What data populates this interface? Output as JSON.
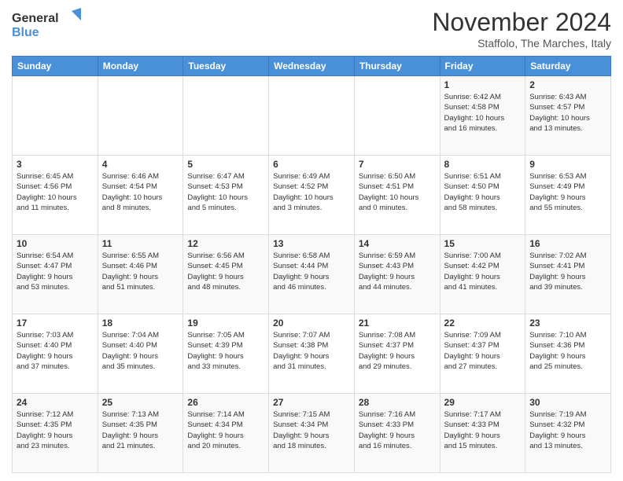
{
  "logo": {
    "line1": "General",
    "line2": "Blue"
  },
  "title": "November 2024",
  "subtitle": "Staffolo, The Marches, Italy",
  "days_header": [
    "Sunday",
    "Monday",
    "Tuesday",
    "Wednesday",
    "Thursday",
    "Friday",
    "Saturday"
  ],
  "weeks": [
    [
      {
        "day": "",
        "info": ""
      },
      {
        "day": "",
        "info": ""
      },
      {
        "day": "",
        "info": ""
      },
      {
        "day": "",
        "info": ""
      },
      {
        "day": "",
        "info": ""
      },
      {
        "day": "1",
        "info": "Sunrise: 6:42 AM\nSunset: 4:58 PM\nDaylight: 10 hours\nand 16 minutes."
      },
      {
        "day": "2",
        "info": "Sunrise: 6:43 AM\nSunset: 4:57 PM\nDaylight: 10 hours\nand 13 minutes."
      }
    ],
    [
      {
        "day": "3",
        "info": "Sunrise: 6:45 AM\nSunset: 4:56 PM\nDaylight: 10 hours\nand 11 minutes."
      },
      {
        "day": "4",
        "info": "Sunrise: 6:46 AM\nSunset: 4:54 PM\nDaylight: 10 hours\nand 8 minutes."
      },
      {
        "day": "5",
        "info": "Sunrise: 6:47 AM\nSunset: 4:53 PM\nDaylight: 10 hours\nand 5 minutes."
      },
      {
        "day": "6",
        "info": "Sunrise: 6:49 AM\nSunset: 4:52 PM\nDaylight: 10 hours\nand 3 minutes."
      },
      {
        "day": "7",
        "info": "Sunrise: 6:50 AM\nSunset: 4:51 PM\nDaylight: 10 hours\nand 0 minutes."
      },
      {
        "day": "8",
        "info": "Sunrise: 6:51 AM\nSunset: 4:50 PM\nDaylight: 9 hours\nand 58 minutes."
      },
      {
        "day": "9",
        "info": "Sunrise: 6:53 AM\nSunset: 4:49 PM\nDaylight: 9 hours\nand 55 minutes."
      }
    ],
    [
      {
        "day": "10",
        "info": "Sunrise: 6:54 AM\nSunset: 4:47 PM\nDaylight: 9 hours\nand 53 minutes."
      },
      {
        "day": "11",
        "info": "Sunrise: 6:55 AM\nSunset: 4:46 PM\nDaylight: 9 hours\nand 51 minutes."
      },
      {
        "day": "12",
        "info": "Sunrise: 6:56 AM\nSunset: 4:45 PM\nDaylight: 9 hours\nand 48 minutes."
      },
      {
        "day": "13",
        "info": "Sunrise: 6:58 AM\nSunset: 4:44 PM\nDaylight: 9 hours\nand 46 minutes."
      },
      {
        "day": "14",
        "info": "Sunrise: 6:59 AM\nSunset: 4:43 PM\nDaylight: 9 hours\nand 44 minutes."
      },
      {
        "day": "15",
        "info": "Sunrise: 7:00 AM\nSunset: 4:42 PM\nDaylight: 9 hours\nand 41 minutes."
      },
      {
        "day": "16",
        "info": "Sunrise: 7:02 AM\nSunset: 4:41 PM\nDaylight: 9 hours\nand 39 minutes."
      }
    ],
    [
      {
        "day": "17",
        "info": "Sunrise: 7:03 AM\nSunset: 4:40 PM\nDaylight: 9 hours\nand 37 minutes."
      },
      {
        "day": "18",
        "info": "Sunrise: 7:04 AM\nSunset: 4:40 PM\nDaylight: 9 hours\nand 35 minutes."
      },
      {
        "day": "19",
        "info": "Sunrise: 7:05 AM\nSunset: 4:39 PM\nDaylight: 9 hours\nand 33 minutes."
      },
      {
        "day": "20",
        "info": "Sunrise: 7:07 AM\nSunset: 4:38 PM\nDaylight: 9 hours\nand 31 minutes."
      },
      {
        "day": "21",
        "info": "Sunrise: 7:08 AM\nSunset: 4:37 PM\nDaylight: 9 hours\nand 29 minutes."
      },
      {
        "day": "22",
        "info": "Sunrise: 7:09 AM\nSunset: 4:37 PM\nDaylight: 9 hours\nand 27 minutes."
      },
      {
        "day": "23",
        "info": "Sunrise: 7:10 AM\nSunset: 4:36 PM\nDaylight: 9 hours\nand 25 minutes."
      }
    ],
    [
      {
        "day": "24",
        "info": "Sunrise: 7:12 AM\nSunset: 4:35 PM\nDaylight: 9 hours\nand 23 minutes."
      },
      {
        "day": "25",
        "info": "Sunrise: 7:13 AM\nSunset: 4:35 PM\nDaylight: 9 hours\nand 21 minutes."
      },
      {
        "day": "26",
        "info": "Sunrise: 7:14 AM\nSunset: 4:34 PM\nDaylight: 9 hours\nand 20 minutes."
      },
      {
        "day": "27",
        "info": "Sunrise: 7:15 AM\nSunset: 4:34 PM\nDaylight: 9 hours\nand 18 minutes."
      },
      {
        "day": "28",
        "info": "Sunrise: 7:16 AM\nSunset: 4:33 PM\nDaylight: 9 hours\nand 16 minutes."
      },
      {
        "day": "29",
        "info": "Sunrise: 7:17 AM\nSunset: 4:33 PM\nDaylight: 9 hours\nand 15 minutes."
      },
      {
        "day": "30",
        "info": "Sunrise: 7:19 AM\nSunset: 4:32 PM\nDaylight: 9 hours\nand 13 minutes."
      }
    ]
  ]
}
